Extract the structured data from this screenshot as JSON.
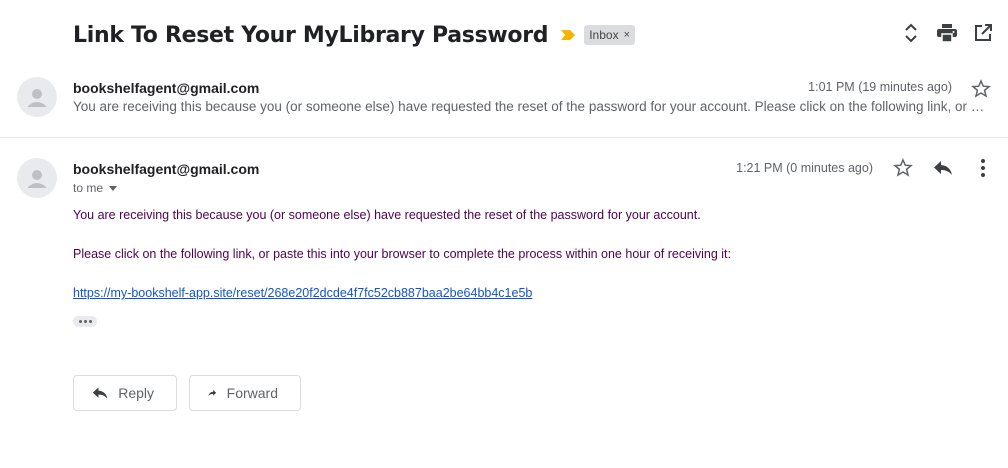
{
  "header": {
    "subject": "Link To Reset Your MyLibrary Password",
    "label": "Inbox",
    "label_remove": "×",
    "importance_color": "#f4b400",
    "icons": [
      "expand-collapse-icon",
      "print-icon",
      "open-in-new-window-icon"
    ]
  },
  "messages": [
    {
      "sender": "bookshelfagent@gmail.com",
      "time": "1:01 PM (19 minutes ago)",
      "snippet": "You are receiving this because you (or someone else) have requested the reset of the password for your account. Please click on the following link, or paste this into your browser to complete the process within one hour of receiving it:"
    },
    {
      "sender": "bookshelfagent@gmail.com",
      "recipient": "to me",
      "time": "1:21 PM (0 minutes ago)",
      "body_line1": "You are receiving this because you (or someone else) have requested the reset of the password for your account.",
      "body_line2": "Please click on the following link, or paste this into your browser to complete the process within one hour of receiving it:",
      "link": "https://my-bookshelf-app.site/reset/268e20f2dcde4f7fc52cb887baa2be64bb4c1e5b"
    }
  ],
  "actions": {
    "reply_label": "Reply",
    "forward_label": "Forward"
  },
  "colors": {
    "body_text": "#500050",
    "link": "#1155cc"
  }
}
